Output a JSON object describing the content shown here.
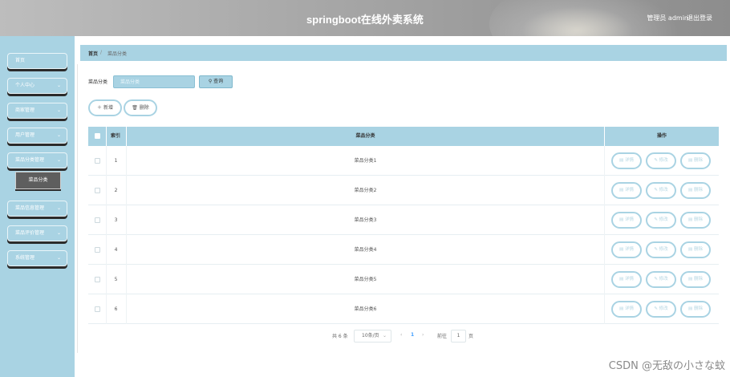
{
  "header": {
    "title": "springboot在线外卖系统",
    "user": "管理员 admin",
    "logout": "退出登录"
  },
  "sidebar": {
    "items": [
      {
        "label": "首页",
        "has_chevron": false
      },
      {
        "label": "个人中心",
        "has_chevron": true
      },
      {
        "label": "商家管理",
        "has_chevron": true
      },
      {
        "label": "用户管理",
        "has_chevron": true
      },
      {
        "label": "菜品分类管理",
        "has_chevron": true
      },
      {
        "label": "菜品信息管理",
        "has_chevron": true
      },
      {
        "label": "菜品评价管理",
        "has_chevron": true
      },
      {
        "label": "系统管理",
        "has_chevron": true
      }
    ],
    "active_submenu": "菜品分类"
  },
  "breadcrumb": {
    "home": "首页",
    "separator": "/",
    "current": "菜品分类"
  },
  "search": {
    "label": "菜品分类",
    "placeholder": "菜品分类",
    "button": "查询",
    "button_icon": "search-icon"
  },
  "actions": {
    "add": "＋ 新增",
    "delete": "删除",
    "delete_icon": "trash-icon"
  },
  "table": {
    "columns": [
      "",
      "索引",
      "菜品分类",
      "操作"
    ],
    "rows": [
      {
        "index": "1",
        "name": "菜品分类1"
      },
      {
        "index": "2",
        "name": "菜品分类2"
      },
      {
        "index": "3",
        "name": "菜品分类3"
      },
      {
        "index": "4",
        "name": "菜品分类4"
      },
      {
        "index": "5",
        "name": "菜品分类5"
      },
      {
        "index": "6",
        "name": "菜品分类6"
      }
    ],
    "row_actions": {
      "detail": "详情",
      "edit": "修改",
      "delete": "删除"
    }
  },
  "pagination": {
    "total": "共 6 条",
    "page_size": "10条/页",
    "current_page": "1",
    "goto_label": "前往",
    "goto_value": "1",
    "page_word": "页"
  },
  "watermark": "CSDN @无敌の小さな蚊",
  "colors": {
    "accent": "#a9d3e3",
    "header": "#a9a9a9",
    "submenu_active": "#5e5e5e",
    "page_link": "#409eff"
  }
}
